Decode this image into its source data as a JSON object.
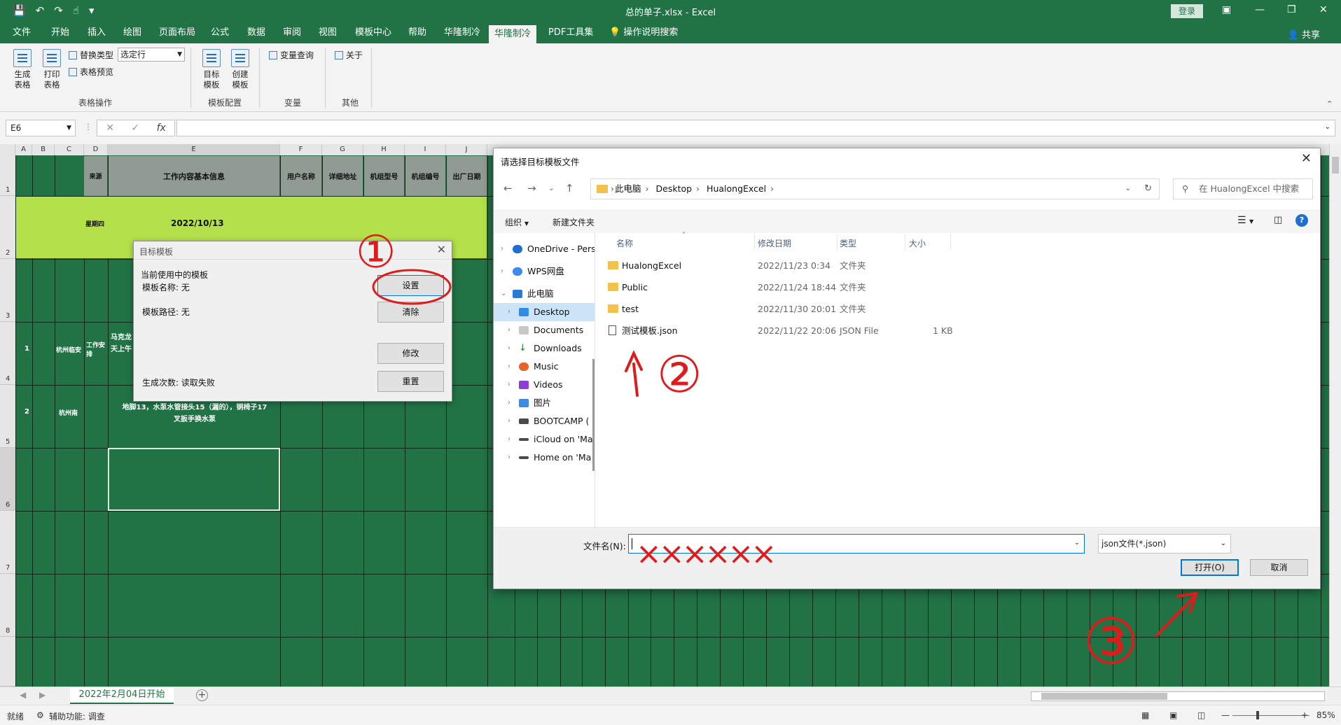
{
  "titlebar": {
    "title": "总的单子.xlsx  -  Excel",
    "login": "登录"
  },
  "tabs": [
    "文件",
    "开始",
    "插入",
    "绘图",
    "页面布局",
    "公式",
    "数据",
    "审阅",
    "视图",
    "模板中心",
    "帮助",
    "华隆制冷",
    "华隆制冷",
    "PDF工具集",
    "操作说明搜索"
  ],
  "share": "共享",
  "ribbon": {
    "gen_table": "生成\n表格",
    "print_table": "打印\n表格",
    "replace_type": "替换类型",
    "select_row": "选定行",
    "table_preview": "表格预览",
    "group1": "表格操作",
    "target_template": "目标\n模板",
    "create_template": "创建\n模板",
    "group2": "模板配置",
    "var_query": "变量查询",
    "group3": "变量",
    "about": "关于",
    "group4": "其他"
  },
  "formula": {
    "namebox": "E6",
    "fx": "fx"
  },
  "sheet": {
    "col_headers": [
      "A",
      "B",
      "C",
      "D",
      "E",
      "F",
      "G",
      "H",
      "I",
      "J"
    ],
    "header_cells": [
      "来源",
      "工作内容基本信息",
      "用户名称",
      "详细地址",
      "机组型号",
      "机组编号",
      "出厂日期"
    ],
    "weekday": "星期四",
    "date": "2022/10/13",
    "row_numbers": [
      "1",
      "2",
      "3",
      "4",
      "5",
      "6",
      "7",
      "8"
    ],
    "r4": {
      "n": "1",
      "city": "杭州临安",
      "type": "工作安排",
      "text": "马克龙\n天上午"
    },
    "r5": {
      "n": "2",
      "city": "杭州南",
      "text": "地脚13，水泵水管接头15（漏的），铜椅子17\n叉扳手换水泵"
    }
  },
  "template_dialog": {
    "title": "目标模板",
    "current": "当前使用中的模板",
    "name_label": "模板名称: 无",
    "path_label": "模板路径: 无",
    "gen_count": "生成次数: 读取失败",
    "btn_set": "设置",
    "btn_clear": "清除",
    "btn_modify": "修改",
    "btn_reset": "重置"
  },
  "file_dialog": {
    "title": "请选择目标模板文件",
    "breadcrumb": [
      "此电脑",
      "Desktop",
      "HualongExcel"
    ],
    "search_placeholder": "在 HualongExcel 中搜索",
    "organize": "组织",
    "new_folder": "新建文件夹",
    "nav_items": [
      "OneDrive - Pers",
      "WPS网盘",
      "此电脑",
      "Desktop",
      "Documents",
      "Downloads",
      "Music",
      "Videos",
      "图片",
      "BOOTCAMP (",
      "iCloud on 'Ma",
      "Home on 'Ma"
    ],
    "columns": {
      "name": "名称",
      "date": "修改日期",
      "type": "类型",
      "size": "大小"
    },
    "files": [
      {
        "name": "HualongExcel",
        "date": "2022/11/23 0:34",
        "type": "文件夹",
        "size": ""
      },
      {
        "name": "Public",
        "date": "2022/11/24 18:44",
        "type": "文件夹",
        "size": ""
      },
      {
        "name": "test",
        "date": "2022/11/30 20:01",
        "type": "文件夹",
        "size": ""
      },
      {
        "name": "测试模板.json",
        "date": "2022/11/22 20:06",
        "type": "JSON File",
        "size": "1 KB"
      }
    ],
    "filename_label": "文件名(N):",
    "filetype": "json文件(*.json)",
    "open": "打开(O)",
    "cancel": "取消"
  },
  "sheet_tab": "2022年2月04日开始",
  "status": {
    "ready": "就绪",
    "accessibility": "辅助功能: 调查",
    "zoom": "85%"
  },
  "annotations": {
    "step1": "①",
    "step2": "②",
    "step3": "③",
    "crosses": "××××××"
  },
  "colors": {
    "excel_green": "#217346",
    "lime": "#b4e04a",
    "red_ink": "#e01b1b",
    "accent": "#0078d7"
  }
}
